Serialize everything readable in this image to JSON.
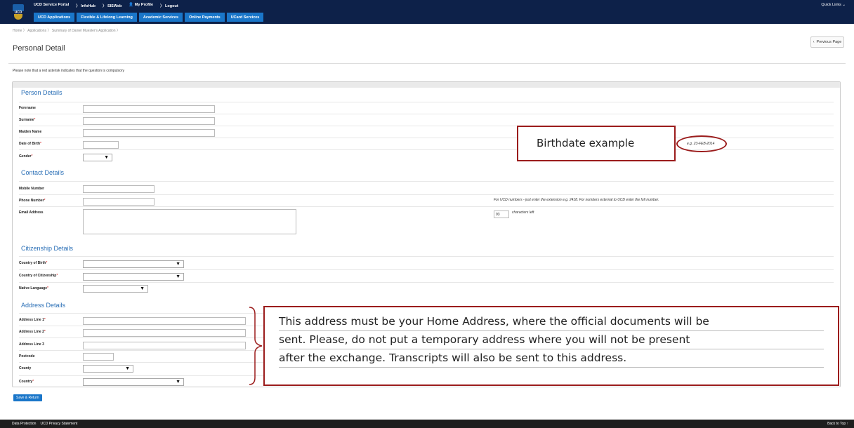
{
  "header": {
    "links": [
      "UCD Service Portal",
      "〉 InfoHub",
      "〉 SISWeb",
      "👤 My Profile",
      "〉 Logout"
    ],
    "quick_links": "Quick Links ⌄",
    "tabs": [
      "UCD Applications",
      "Flexible & Lifelong Learning",
      "Academic Services",
      "Online Payments",
      "UCard Services"
    ],
    "logo_text": "UCD"
  },
  "breadcrumb": "Home 〉 Applications 〉 Summary of Daniel Muesler's Application 〉",
  "page_title": "Personal Detail",
  "previous_page": "Previous Page",
  "note": "Please note that a red asterisk indicates that the question is compulsory",
  "sections": {
    "person": "Person Details",
    "contact": "Contact Details",
    "citizenship": "Citizenship Details",
    "address": "Address Details"
  },
  "labels": {
    "forename": "Forename",
    "surname": "Surname",
    "maiden": "Maiden Name",
    "dob": "Date of Birth",
    "gender": "Gender",
    "mobile": "Mobile Number",
    "phone": "Phone Number",
    "email": "Email Address",
    "country_birth": "Country of Birth",
    "country_citizenship": "Country of Citizenship",
    "native_language": "Native Language",
    "addr1": "Address Line 1",
    "addr2": "Address Line 2",
    "addr3": "Address Line 3",
    "postcode": "Postcode",
    "county": "County",
    "country": "Country"
  },
  "asterisk": "*",
  "dob_example": "e.g. 23-FEB-2014",
  "phone_help": "For UCD numbers - just enter the extension e.g. 2418. For numbers external to UCD enter the full number.",
  "chars_left_value": "93",
  "chars_left_label": "characters left",
  "save_button": "Save & Return",
  "footer": {
    "links": [
      "Data Protection",
      "UCD Privacy Statement"
    ],
    "back_to_top": "Back to Top ↑"
  },
  "annotations": {
    "birthdate": "Birthdate example",
    "address_lines": [
      "This address must be your Home Address, where the official documents will be",
      "sent. Please, do not put a temporary address where you will not be present",
      "after the exchange. Transcripts will also be sent to this address."
    ]
  },
  "colors": {
    "navy": "#0d2149",
    "tab_blue": "#1a76c9",
    "section_blue": "#2a6fb6",
    "annotation_red": "#9b1c1c"
  }
}
